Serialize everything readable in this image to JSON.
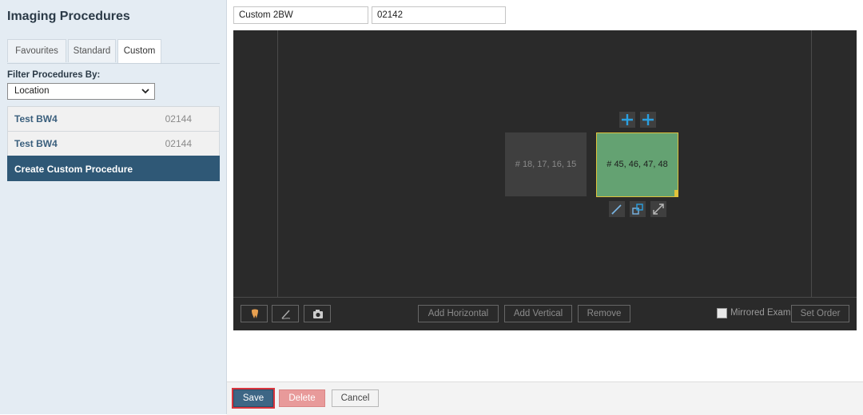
{
  "sidebar": {
    "title": "Imaging Procedures",
    "tabs": [
      {
        "label": "Favourites",
        "active": false
      },
      {
        "label": "Standard",
        "active": false
      },
      {
        "label": "Custom",
        "active": true
      }
    ],
    "filter_label": "Filter Procedures By:",
    "filter_value": "Location",
    "procedures": [
      {
        "name": "Test BW4",
        "code": "02144"
      },
      {
        "name": "Test BW4",
        "code": "02144"
      }
    ],
    "create_label": "Create Custom Procedure"
  },
  "editor": {
    "name_value": "Custom 2BW",
    "code_value": "02142",
    "images": [
      {
        "label": "# 18, 17, 16, 15",
        "selected": false
      },
      {
        "label": "# 45, 46, 47, 48",
        "selected": true
      }
    ],
    "toolbar": {
      "add_horizontal": "Add Horizontal",
      "add_vertical": "Add Vertical",
      "remove": "Remove",
      "mirrored_label": "Mirrored Exam",
      "set_order": "Set Order"
    }
  },
  "footer": {
    "save": "Save",
    "delete": "Delete",
    "cancel": "Cancel"
  },
  "colors": {
    "accent": "#2f5876",
    "selected_image": "#64a272",
    "selection_border": "#e0c23c",
    "add_icon": "#2a9fe0",
    "delete_button": "#e89a9a"
  },
  "icons": [
    "chevron-down-icon",
    "plus-icon",
    "pencil-icon",
    "rotate-icon",
    "resize-icon",
    "tooth-icon",
    "pen-icon",
    "camera-icon"
  ]
}
